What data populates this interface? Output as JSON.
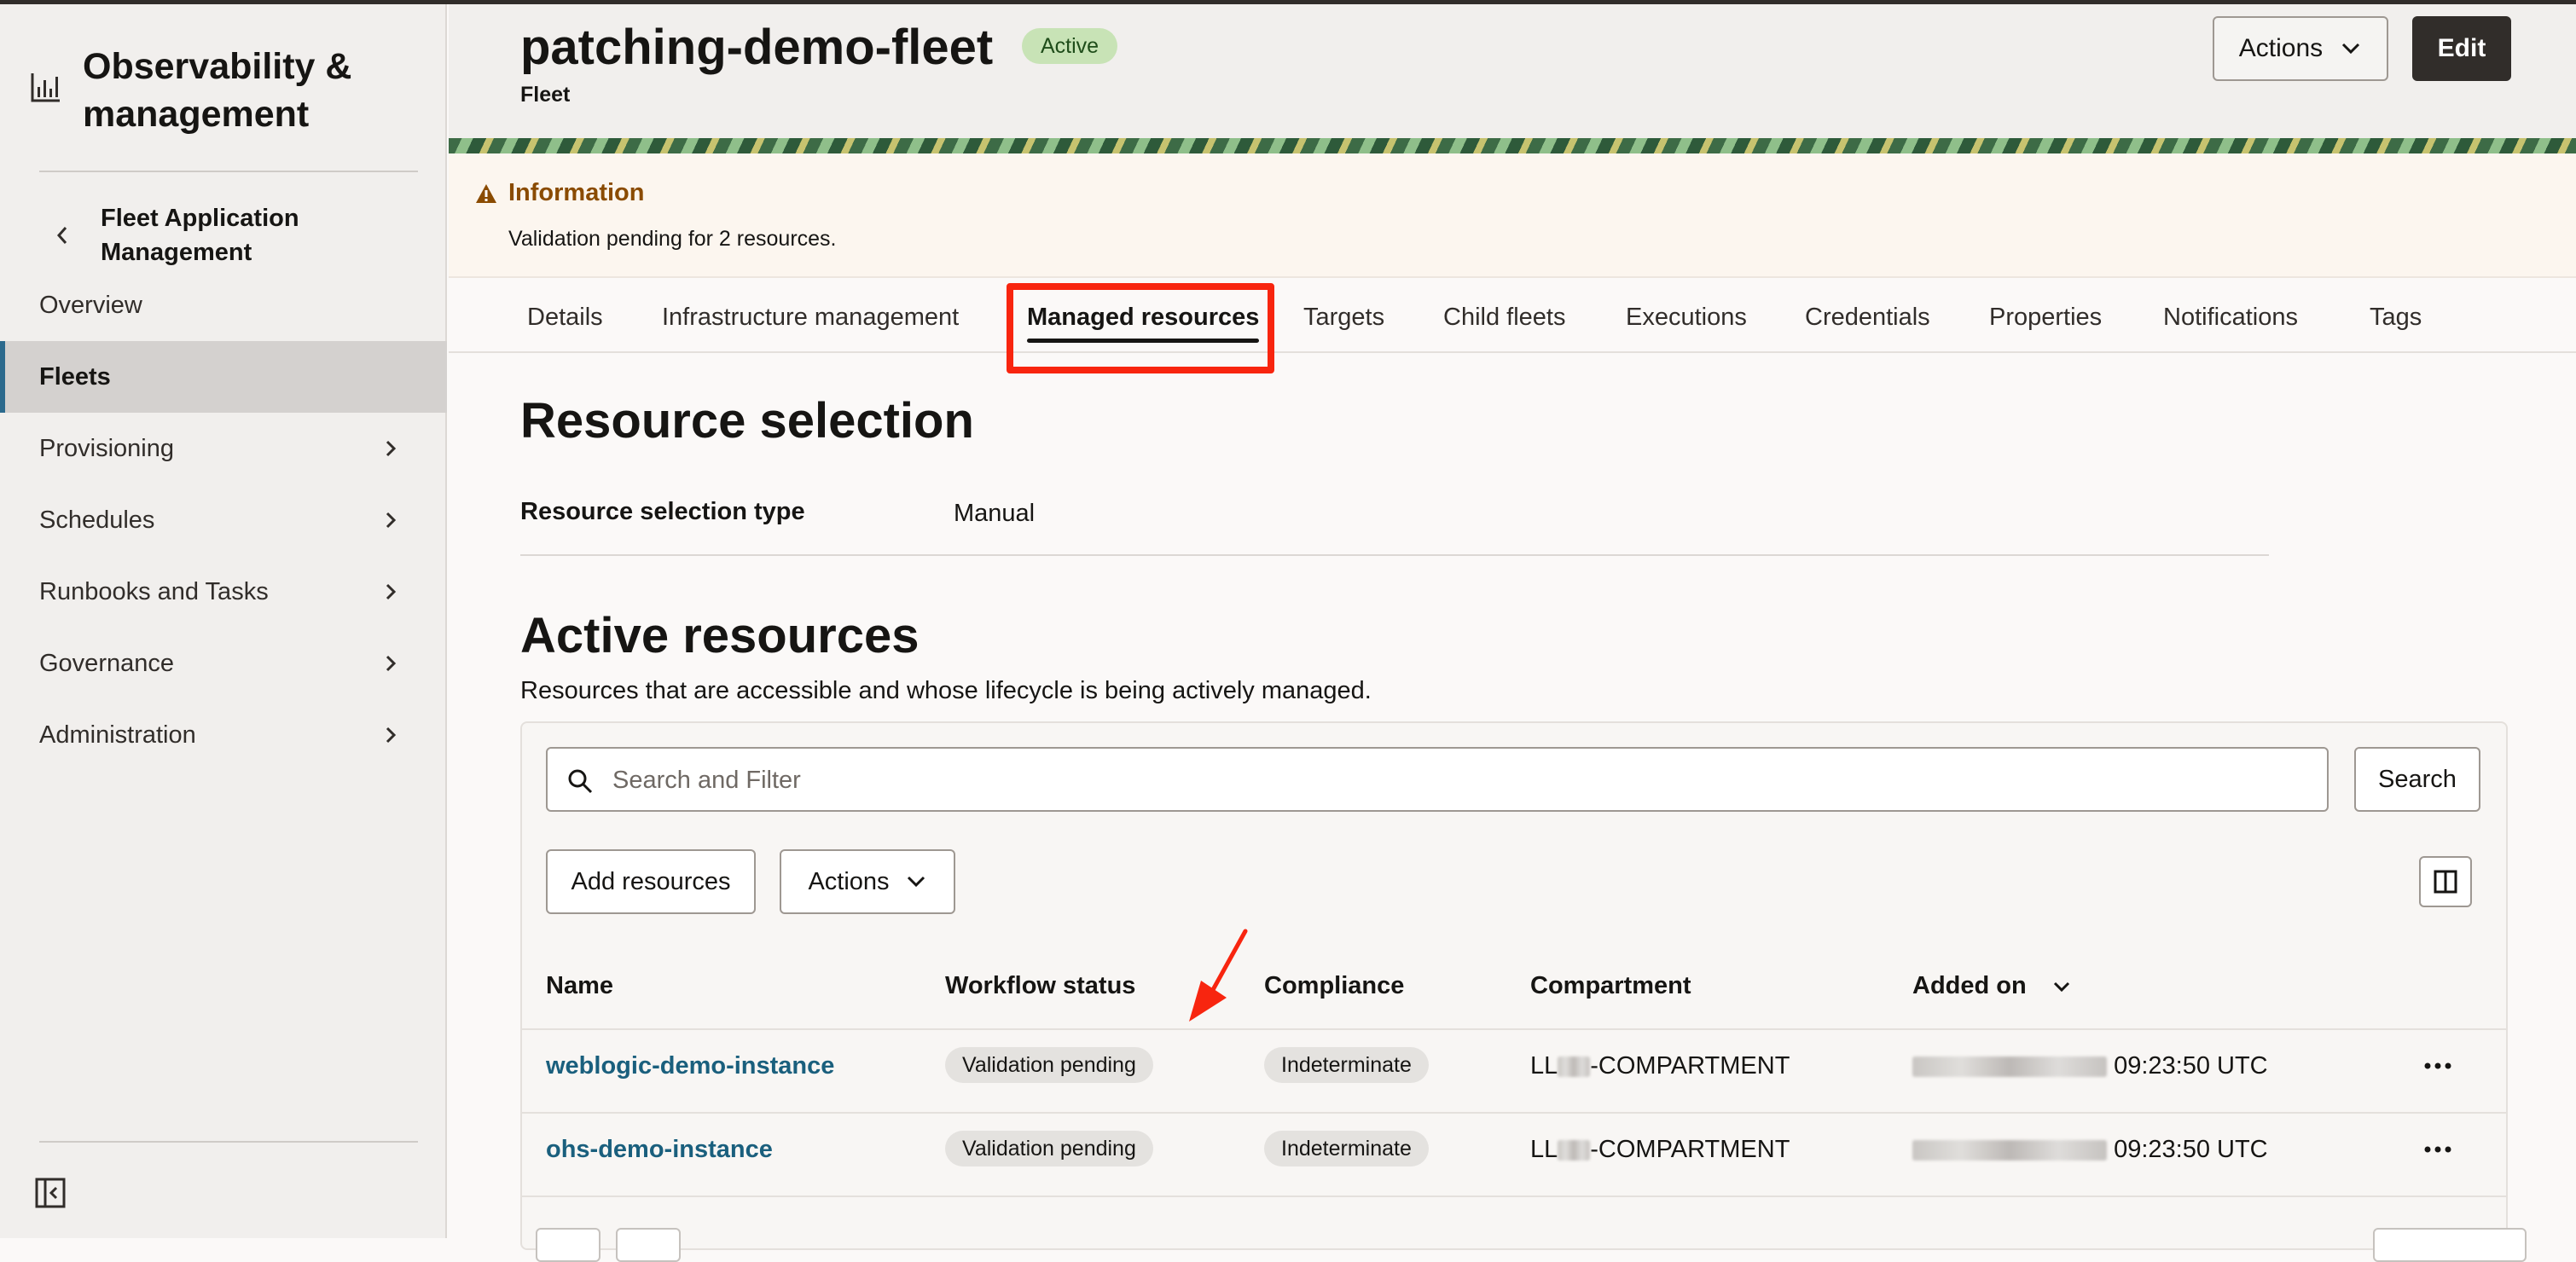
{
  "sidebar": {
    "title": "Observability & management",
    "section": "Fleet Application Management",
    "items": [
      {
        "label": "Overview"
      },
      {
        "label": "Fleets"
      },
      {
        "label": "Provisioning"
      },
      {
        "label": "Schedules"
      },
      {
        "label": "Runbooks and Tasks"
      },
      {
        "label": "Governance"
      },
      {
        "label": "Administration"
      }
    ],
    "active_item": "Fleets",
    "icons": {
      "logo": "chart-icon",
      "back": "chevron-left-icon",
      "expand": "chevron-right-icon",
      "collapse": "collapse-sidebar-icon"
    }
  },
  "header": {
    "title": "patching-demo-fleet",
    "status_badge": "Active",
    "subtitle": "Fleet",
    "actions_label": "Actions",
    "edit_label": "Edit"
  },
  "info": {
    "title": "Information",
    "message": "Validation pending for 2 resources.",
    "icon": "warning-icon"
  },
  "tabs": [
    {
      "label": "Details"
    },
    {
      "label": "Infrastructure management"
    },
    {
      "label": "Managed resources"
    },
    {
      "label": "Targets"
    },
    {
      "label": "Child fleets"
    },
    {
      "label": "Executions"
    },
    {
      "label": "Credentials"
    },
    {
      "label": "Properties"
    },
    {
      "label": "Notifications"
    },
    {
      "label": "Tags"
    }
  ],
  "active_tab": "Managed resources",
  "resource_selection": {
    "heading": "Resource selection",
    "type_label": "Resource selection type",
    "type_value": "Manual"
  },
  "active_resources": {
    "heading": "Active resources",
    "description": "Resources that are accessible and whose lifecycle is being actively managed.",
    "search_placeholder": "Search and Filter",
    "search_button": "Search",
    "add_button": "Add resources",
    "actions_button": "Actions",
    "columns": [
      "Name",
      "Workflow status",
      "Compliance",
      "Compartment",
      "Added on"
    ],
    "rows": [
      {
        "name": "weblogic-demo-instance",
        "workflow_status": "Validation pending",
        "compliance": "Indeterminate",
        "compartment_prefix": "LL",
        "compartment_suffix": "-COMPARTMENT",
        "added_time": "09:23:50 UTC"
      },
      {
        "name": "ohs-demo-instance",
        "workflow_status": "Validation pending",
        "compliance": "Indeterminate",
        "compartment_prefix": "LL",
        "compartment_suffix": "-COMPARTMENT",
        "added_time": "09:23:50 UTC"
      }
    ]
  },
  "colors": {
    "accent": "#f8250f",
    "link": "#1a5f7d",
    "sidebar_active_bar": "#2c6a8d",
    "edit_button": "#312d2a",
    "badge_active": "#c8e3b6",
    "info_title": "#8a4b00"
  }
}
